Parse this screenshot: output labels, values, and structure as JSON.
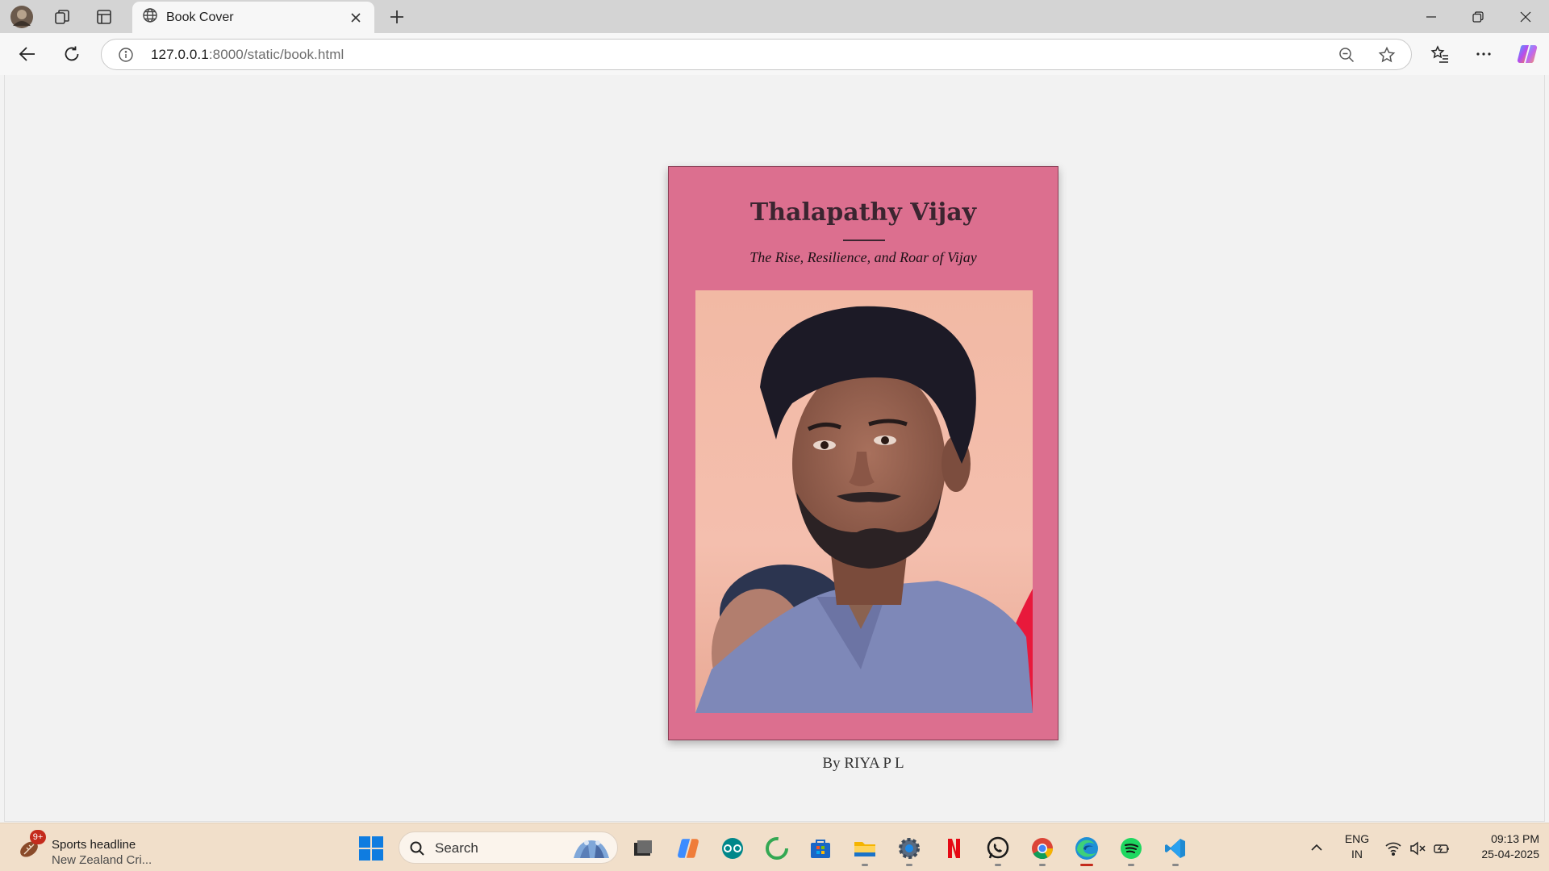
{
  "browser": {
    "tab_title": "Book Cover",
    "url_host": "127.0.0.1",
    "url_path": ":8000/static/book.html",
    "icons": [
      "profile-avatar-icon",
      "workspaces-icon",
      "tab-actions-icon",
      "globe-icon",
      "close-icon",
      "plus-icon",
      "minimize-icon",
      "restore-icon",
      "back-icon",
      "refresh-icon",
      "info-icon",
      "zoom-out-icon",
      "star-icon",
      "favorites-icon",
      "more-icon",
      "copilot-icon"
    ]
  },
  "book": {
    "title": "Thalapathy Vijay",
    "subtitle": "The Rise, Resilience, and Roar of Vijay",
    "byline": "By RIYA P L",
    "cover_color": "#dc6f8f"
  },
  "taskbar": {
    "news_badge": "9+",
    "news_headline": "Sports headline",
    "news_sub": "New Zealand Cri...",
    "search_placeholder": "Search",
    "lang_line1": "ENG",
    "lang_line2": "IN",
    "time": "09:13 PM",
    "date": "25-04-2025",
    "apps": [
      "file-manager-icon",
      "copilot-app-icon",
      "arduino-icon",
      "android-studio-icon",
      "ms-store-icon",
      "file-explorer-icon",
      "settings-icon",
      "netflix-icon",
      "whatsapp-icon",
      "chrome-icon",
      "edge-icon",
      "spotify-icon",
      "vscode-icon"
    ]
  }
}
